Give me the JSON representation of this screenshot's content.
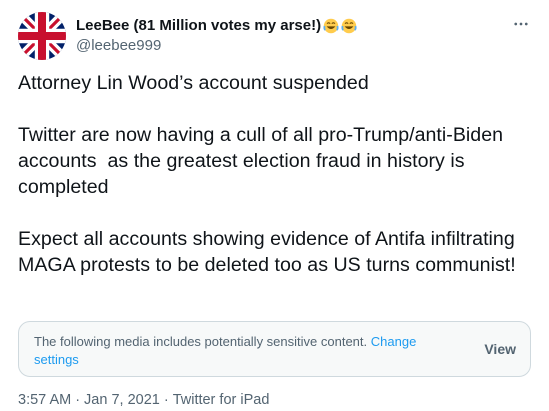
{
  "author": {
    "display_name": "LeeBee (81 Million votes my arse!)",
    "handle": "@leebee999",
    "emoji": "face-with-tears-of-joy"
  },
  "tweet": {
    "text": "Attorney Lin Wood’s account suspended\n\nTwitter are now having a cull of all pro-Trump/anti-Biden accounts  as the greatest election fraud in history is completed\n\nExpect all accounts showing evidence of Antifa infiltrating MAGA protests to be deleted too as US turns communist!"
  },
  "sensitive_notice": {
    "message": "The following media includes potentially sensitive content.",
    "link_label": "Change settings",
    "view_label": "View"
  },
  "meta": {
    "time": "3:57 AM",
    "separator": "·",
    "date": "Jan 7, 2021",
    "source": "Twitter for iPad"
  },
  "colors": {
    "link": "#1d9bf0",
    "secondary_text": "#536471",
    "border": "#cfd9de"
  }
}
